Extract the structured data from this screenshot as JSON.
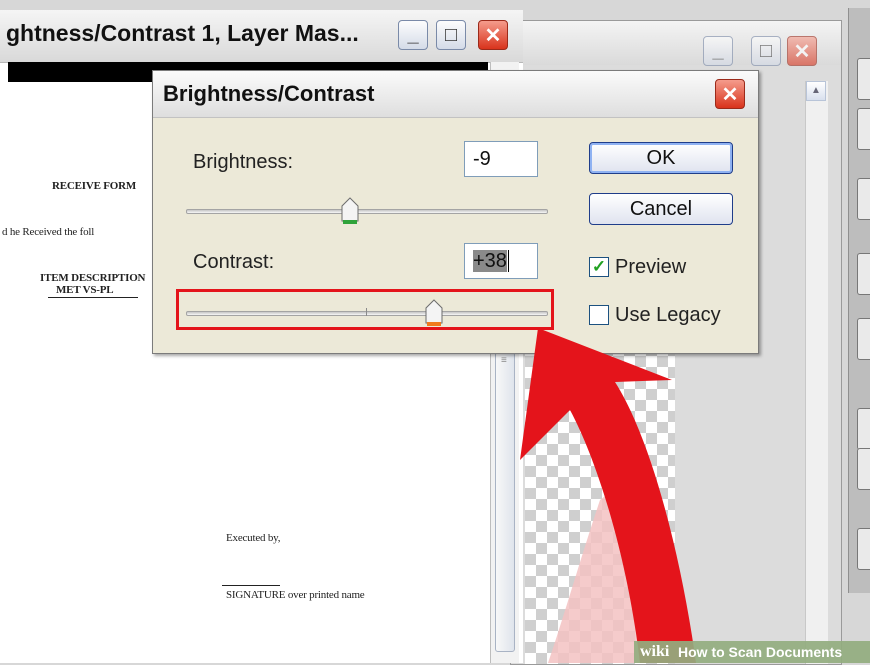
{
  "document_window": {
    "title": "ghtness/Contrast 1, Layer Mas...",
    "page_lines": [
      "RECEIVE FORM",
      "d he  Received the foll",
      "ITEM DESCRIPTION",
      "MET VS-PL",
      "Executed by,",
      "SIGNATURE over  printed name"
    ]
  },
  "dialog": {
    "title": "Brightness/Contrast",
    "brightness_label": "Brightness:",
    "brightness_value": "-9",
    "brightness_level": -9,
    "contrast_label": "Contrast:",
    "contrast_value": "+38",
    "contrast_level": 38,
    "ok_label": "OK",
    "cancel_label": "Cancel",
    "preview_label": "Preview",
    "preview_checked": true,
    "legacy_label": "Use Legacy",
    "legacy_checked": false
  },
  "watermark": {
    "logo": "wiki",
    "text": "How to Scan Documents"
  },
  "colors": {
    "highlight": "#e4141b",
    "accent_green": "#21a121",
    "dialog_bg": "#ece9d8"
  },
  "icons": [
    "minimize-icon",
    "maximize-icon",
    "close-icon",
    "checkmark-icon",
    "slider-thumb-icon",
    "arrow-annotation"
  ]
}
